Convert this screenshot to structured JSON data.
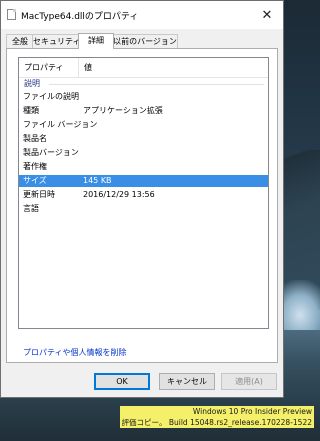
{
  "window": {
    "title": "MacType64.dllのプロパティ",
    "close_glyph": "✕"
  },
  "tabs": [
    {
      "label": "全般"
    },
    {
      "label": "セキュリティ"
    },
    {
      "label": "詳細"
    },
    {
      "label": "以前のバージョン"
    }
  ],
  "active_tab": "詳細",
  "details": {
    "columns": {
      "property": "プロパティ",
      "value": "値"
    },
    "group": "説明",
    "rows": [
      {
        "key": "ファイルの説明",
        "value": ""
      },
      {
        "key": "種類",
        "value": "アプリケーション拡張"
      },
      {
        "key": "ファイル バージョン",
        "value": ""
      },
      {
        "key": "製品名",
        "value": ""
      },
      {
        "key": "製品バージョン",
        "value": ""
      },
      {
        "key": "著作権",
        "value": ""
      },
      {
        "key": "サイズ",
        "value": "145 KB"
      },
      {
        "key": "更新日時",
        "value": "2016/12/29 13:56"
      },
      {
        "key": "言語",
        "value": ""
      }
    ],
    "selected_row": "サイズ"
  },
  "remove_link": "プロパティや個人情報を削除",
  "buttons": {
    "ok": "OK",
    "cancel": "キャンセル",
    "apply": "適用(A)"
  },
  "watermark": {
    "line1": "Windows 10 Pro Insider Preview",
    "line2": "評価コピー。 Build 15048.rs2_release.170228-1522"
  },
  "colors": {
    "selection": "#3a8ee6",
    "link": "#0033cc",
    "default_button_border": "#0078d7",
    "watermark_highlight": "#f4f06a"
  }
}
